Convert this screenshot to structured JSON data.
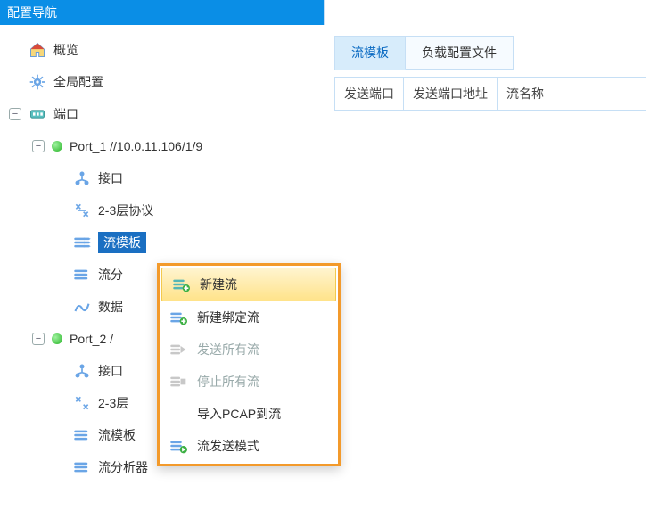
{
  "panel": {
    "title": "配置导航"
  },
  "tree": {
    "overview": "概览",
    "global": "全局配置",
    "ports_root": "端口",
    "port1": {
      "label": "Port_1 //10.0.11.106/1/9",
      "iface": "接口",
      "l23": "2-3层协议",
      "flow_template": "流模板",
      "flow_split": "流分",
      "data": "数据"
    },
    "port2": {
      "label": "Port_2 /",
      "iface": "接口",
      "l23": "2-3层",
      "flow_template": "流模板",
      "flow_analyzer": "流分析器"
    }
  },
  "context_menu": {
    "new_flow": "新建流",
    "new_bound_flow": "新建绑定流",
    "send_all": "发送所有流",
    "stop_all": "停止所有流",
    "import_pcap": "导入PCAP到流",
    "send_mode": "流发送模式"
  },
  "tabs": {
    "flow_template": "流模板",
    "payload_config": "负载配置文件"
  },
  "grid": {
    "send_port": "发送端口",
    "send_port_addr": "发送端口地址",
    "flow_name": "流名称"
  }
}
